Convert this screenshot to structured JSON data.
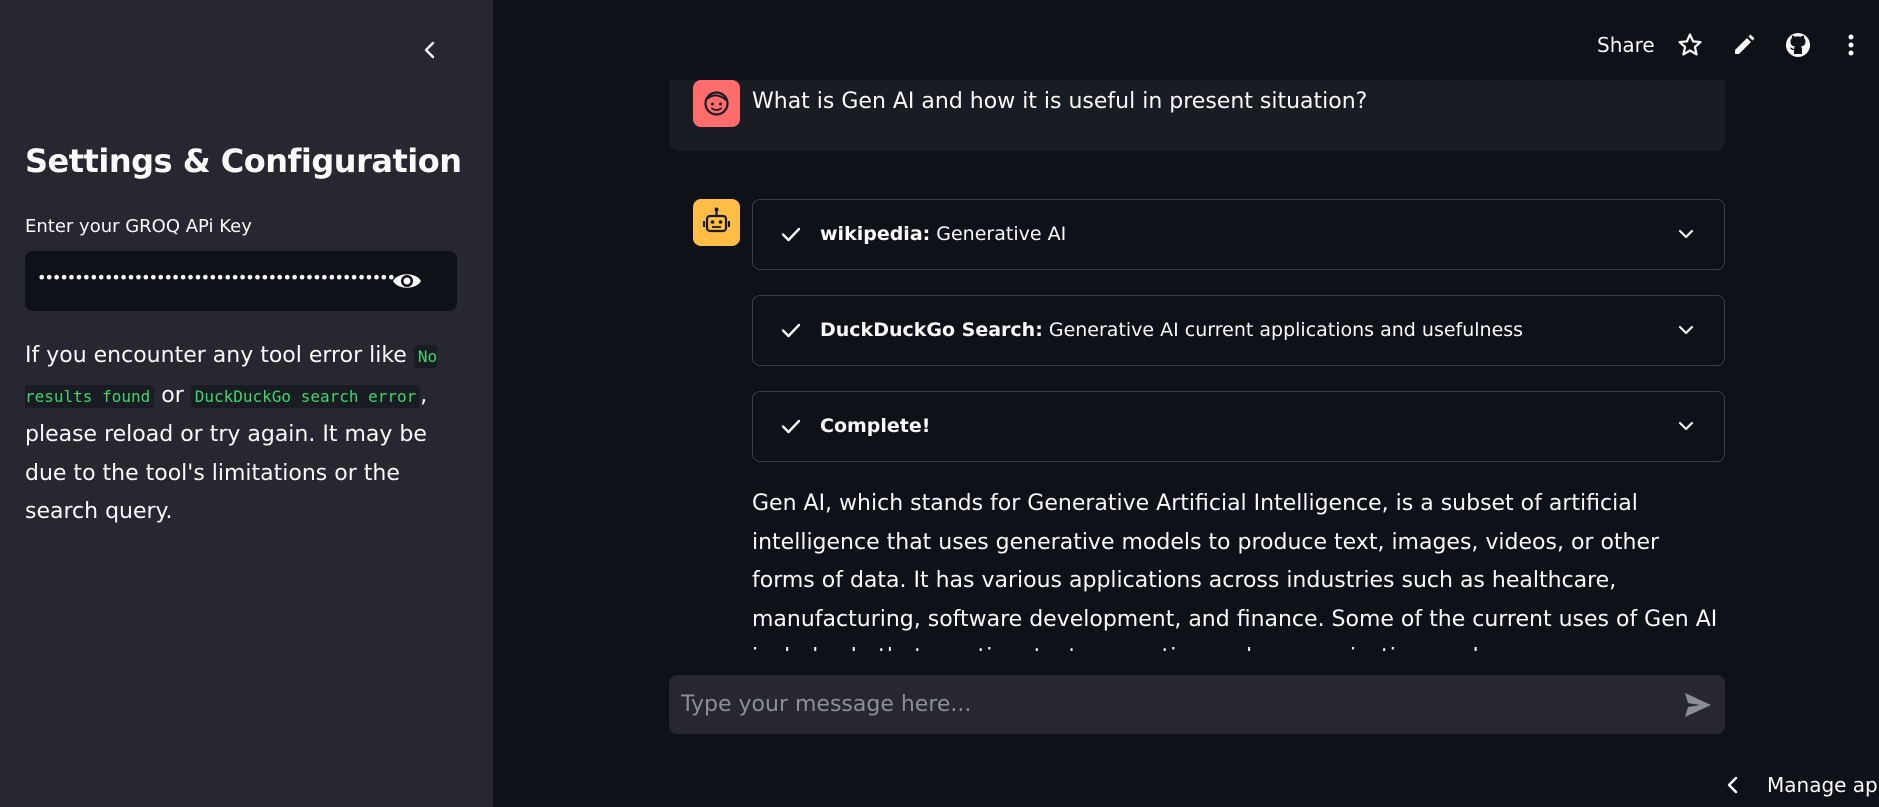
{
  "sidebar": {
    "title": "Settings & Configuration",
    "api_key_label": "Enter your GROQ APi Key",
    "api_key_value": "••••••••••••••••••••••••••••••••••••••••••••••••••••••••••••",
    "note_prefix": "If you encounter any tool error like ",
    "note_code_1": "No results found",
    "note_or": " or ",
    "note_code_2": "DuckDuckGo search error",
    "note_suffix": ", please reload or try again. It may be due to the tool's limitations or the search query."
  },
  "topbar": {
    "share_label": "Share"
  },
  "chat": {
    "user_message": "What is Gen AI and how it is useful in present situation?",
    "steps": [
      {
        "tool": "wikipedia:",
        "query": " Generative AI"
      },
      {
        "tool": "DuckDuckGo Search:",
        "query": " Generative AI current applications and usefulness"
      },
      {
        "tool": "Complete!",
        "query": ""
      }
    ],
    "answer": "Gen AI, which stands for Generative Artificial Intelligence, is a subset of artificial intelligence that uses generative models to produce text, images, videos, or other forms of data. It has various applications across industries such as healthcare, manufacturing, software development, and finance. Some of the current uses of Gen AI include chatbot creation, text generation and summarization, and more."
  },
  "input": {
    "placeholder": "Type your message here..."
  },
  "footer": {
    "manage_label": "Manage app"
  },
  "colors": {
    "sidebar_bg": "#262730",
    "main_bg": "#0e1117",
    "user_avatar": "#ff6c6c",
    "bot_avatar": "#ffbd45",
    "code_text": "#3dd56d"
  }
}
